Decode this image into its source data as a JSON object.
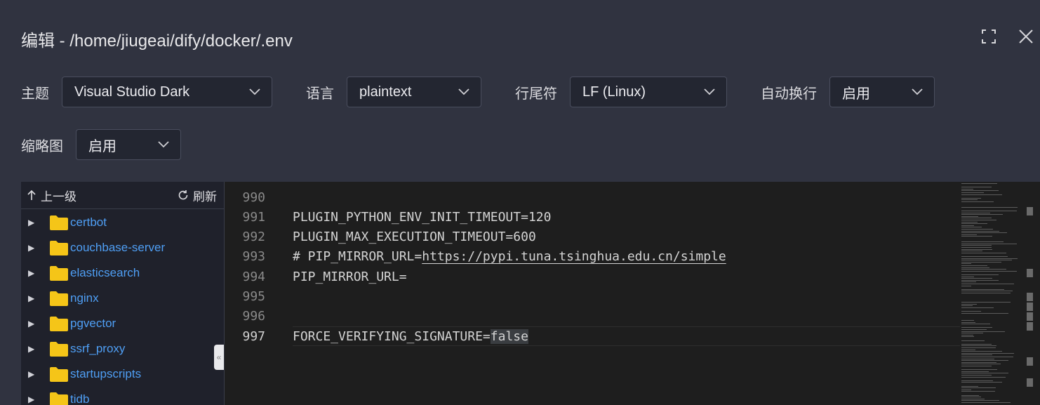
{
  "dialog": {
    "title": "编辑 - /home/jiugeai/dify/docker/.env"
  },
  "options": {
    "theme": {
      "label": "主题",
      "value": "Visual Studio Dark"
    },
    "language": {
      "label": "语言",
      "value": "plaintext"
    },
    "eol": {
      "label": "行尾符",
      "value": "LF (Linux)"
    },
    "wordwrap": {
      "label": "自动换行",
      "value": "启用"
    },
    "minimap": {
      "label": "缩略图",
      "value": "启用"
    }
  },
  "tree": {
    "up_label": "上一级",
    "refresh_label": "刷新",
    "items": [
      "certbot",
      "couchbase-server",
      "elasticsearch",
      "nginx",
      "pgvector",
      "ssrf_proxy",
      "startupscripts",
      "tidb"
    ]
  },
  "editor": {
    "lines": [
      {
        "num": "990",
        "text": ""
      },
      {
        "num": "991",
        "text": "PLUGIN_PYTHON_ENV_INIT_TIMEOUT=120"
      },
      {
        "num": "992",
        "text": "PLUGIN_MAX_EXECUTION_TIMEOUT=600"
      },
      {
        "num": "993",
        "prefix": "# PIP_MIRROR_URL=",
        "url": "https://pypi.tuna.tsinghua.edu.cn/simple"
      },
      {
        "num": "994",
        "text": "PIP_MIRROR_URL="
      },
      {
        "num": "995",
        "text": ""
      },
      {
        "num": "996",
        "text": ""
      },
      {
        "num": "997",
        "prefix": "FORCE_VERIFYING_SIGNATURE=",
        "highlight": "false"
      }
    ]
  },
  "colors": {
    "link": "#4f9ff5",
    "folder": "#f5c518",
    "editor_bg": "#1e1e1e"
  }
}
